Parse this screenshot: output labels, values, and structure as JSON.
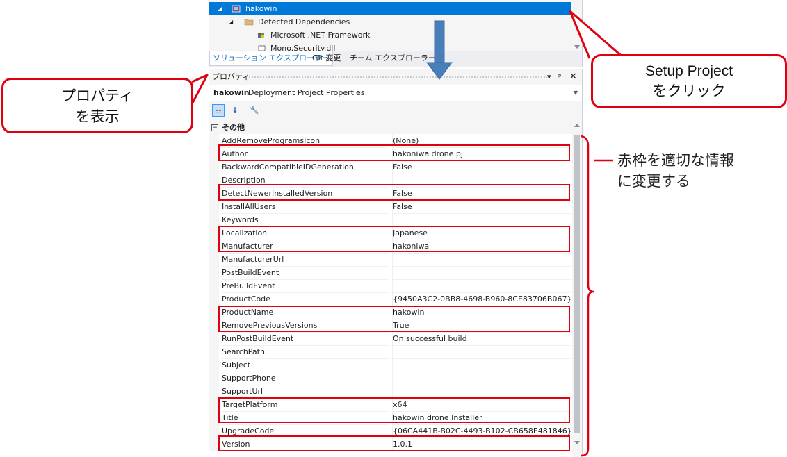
{
  "tree": {
    "items": [
      {
        "label": "hakowin",
        "selected": true
      },
      {
        "label": "Detected Dependencies"
      },
      {
        "label": "Microsoft .NET Framework"
      },
      {
        "label": "Mono.Security.dll"
      }
    ]
  },
  "tabs": [
    {
      "label": "ソリューション エクスプローラー",
      "active": true
    },
    {
      "label": "Git 変更"
    },
    {
      "label": "チーム エクスプローラー"
    }
  ],
  "properties": {
    "title": "プロパティ",
    "pin_glyph": "▾ ⊥ ✕",
    "object_name": "hakowin",
    "object_desc": "Deployment Project Properties",
    "category": "その他",
    "rows": [
      {
        "name": "AddRemoveProgramsIcon",
        "value": "(None)"
      },
      {
        "name": "Author",
        "value": "hakoniwa drone pj"
      },
      {
        "name": "BackwardCompatibleIDGeneration",
        "value": "False"
      },
      {
        "name": "Description",
        "value": ""
      },
      {
        "name": "DetectNewerInstalledVersion",
        "value": "False"
      },
      {
        "name": "InstallAllUsers",
        "value": "False"
      },
      {
        "name": "Keywords",
        "value": ""
      },
      {
        "name": "Localization",
        "value": "Japanese"
      },
      {
        "name": "Manufacturer",
        "value": "hakoniwa"
      },
      {
        "name": "ManufacturerUrl",
        "value": ""
      },
      {
        "name": "PostBuildEvent",
        "value": ""
      },
      {
        "name": "PreBuildEvent",
        "value": ""
      },
      {
        "name": "ProductCode",
        "value": "{9450A3C2-0BB8-4698-B960-8CE83706B067}"
      },
      {
        "name": "ProductName",
        "value": "hakowin"
      },
      {
        "name": "RemovePreviousVersions",
        "value": "True"
      },
      {
        "name": "RunPostBuildEvent",
        "value": "On successful build"
      },
      {
        "name": "SearchPath",
        "value": ""
      },
      {
        "name": "Subject",
        "value": ""
      },
      {
        "name": "SupportPhone",
        "value": ""
      },
      {
        "name": "SupportUrl",
        "value": ""
      },
      {
        "name": "TargetPlatform",
        "value": "x64"
      },
      {
        "name": "Title",
        "value": "hakowin drone Installer"
      },
      {
        "name": "UpgradeCode",
        "value": "{06CA441B-B02C-4493-B102-CB658E481846}"
      },
      {
        "name": "Version",
        "value": "1.0.1"
      }
    ]
  },
  "callouts": {
    "left_line1": "プロパティ",
    "left_line2": "を表示",
    "right_line1": "Setup Project",
    "right_line2": "をクリック",
    "note_line1": "赤枠を適切な情報",
    "note_line2": "に変更する"
  },
  "colors": {
    "highlight": "#e00010",
    "selection": "#0078d7",
    "arrow": "#4a7ebb"
  }
}
